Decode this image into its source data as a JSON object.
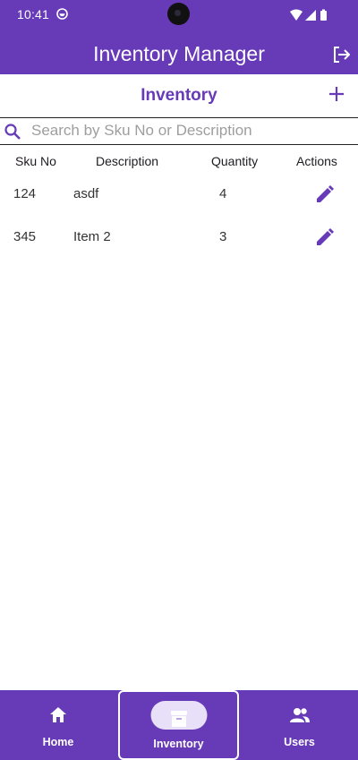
{
  "status_bar": {
    "time": "10:41"
  },
  "app_bar": {
    "title": "Inventory Manager"
  },
  "page": {
    "title": "Inventory"
  },
  "search": {
    "placeholder": "Search by Sku No or Description",
    "value": ""
  },
  "table": {
    "headers": {
      "sku": "Sku No",
      "description": "Description",
      "quantity": "Quantity",
      "actions": "Actions"
    },
    "rows": [
      {
        "sku": "124",
        "description": "asdf",
        "quantity": "4"
      },
      {
        "sku": "345",
        "description": "Item 2",
        "quantity": "3"
      }
    ]
  },
  "bottom_nav": {
    "items": [
      {
        "label": "Home",
        "icon": "home-icon",
        "active": false
      },
      {
        "label": "Inventory",
        "icon": "inventory-box-icon",
        "active": true
      },
      {
        "label": "Users",
        "icon": "users-icon",
        "active": false
      }
    ]
  },
  "colors": {
    "primary": "#673ab7",
    "active_pill": "#e8dff8",
    "surface": "#ffffff"
  }
}
